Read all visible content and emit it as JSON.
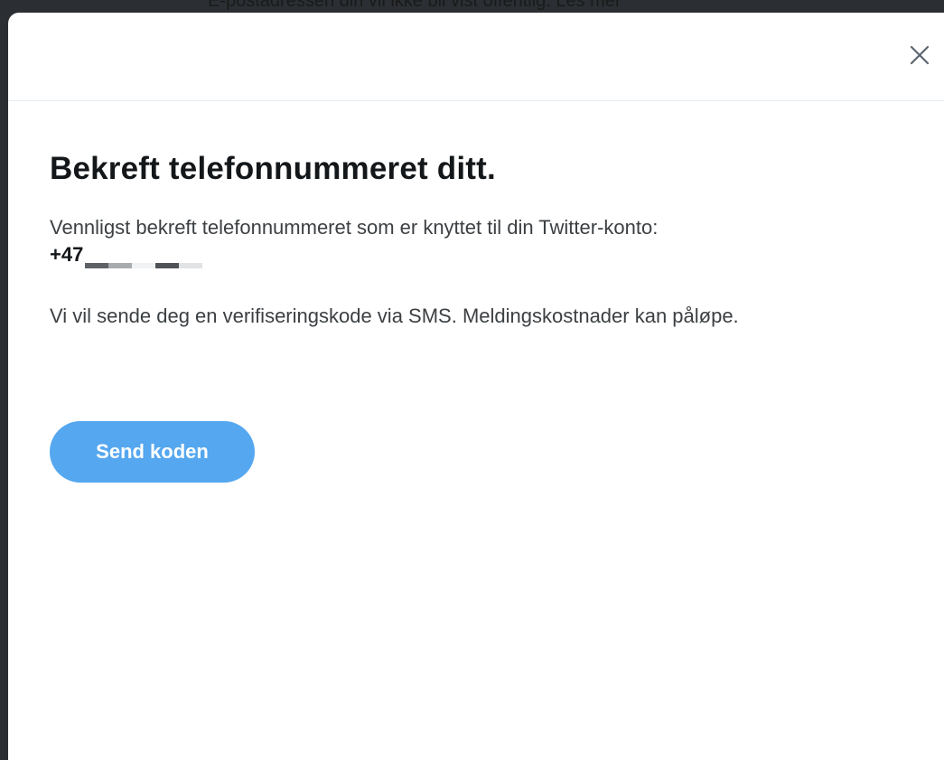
{
  "backdrop": {
    "partial_text": "E-postadressen din vil ikke bli vist offentlig. Les mer"
  },
  "dialog": {
    "close_icon": "close-icon",
    "title": "Bekreft telefonnummeret ditt.",
    "confirm_text": "Vennligst bekreft telefonnummeret som er knyttet til din Twitter-konto:",
    "phone_prefix": "+47",
    "sms_text": "Vi vil sende deg en verifiseringskode via SMS. Meldingskostnader kan påløpe.",
    "send_button_label": "Send koden"
  },
  "colors": {
    "accent": "#55a7ef",
    "title": "#14171a",
    "body_text": "#3c4043",
    "backdrop": "#2b2f33"
  }
}
